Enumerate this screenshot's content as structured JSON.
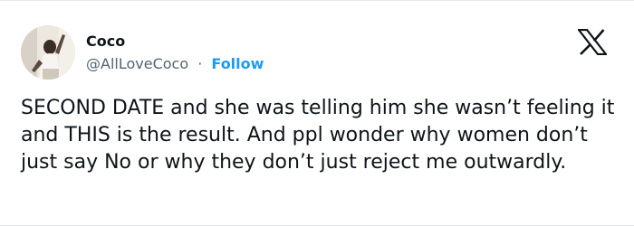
{
  "tweet": {
    "author_name": "Coco",
    "handle": "@AllLoveCoco",
    "separator": "·",
    "follow_label": "Follow",
    "text": "SECOND DATE and she was telling him she wasn’t feeling it and THIS is the result. And ppl wonder why women don’t just say No or why they don’t just reject me outwardly."
  },
  "icons": {
    "avatar": "profile-photo",
    "platform_logo": "x-logo-icon"
  },
  "colors": {
    "text": "#0f1419",
    "secondary_text": "#536471",
    "follow_link": "#1d9bf0",
    "border": "#e6e8ea"
  }
}
